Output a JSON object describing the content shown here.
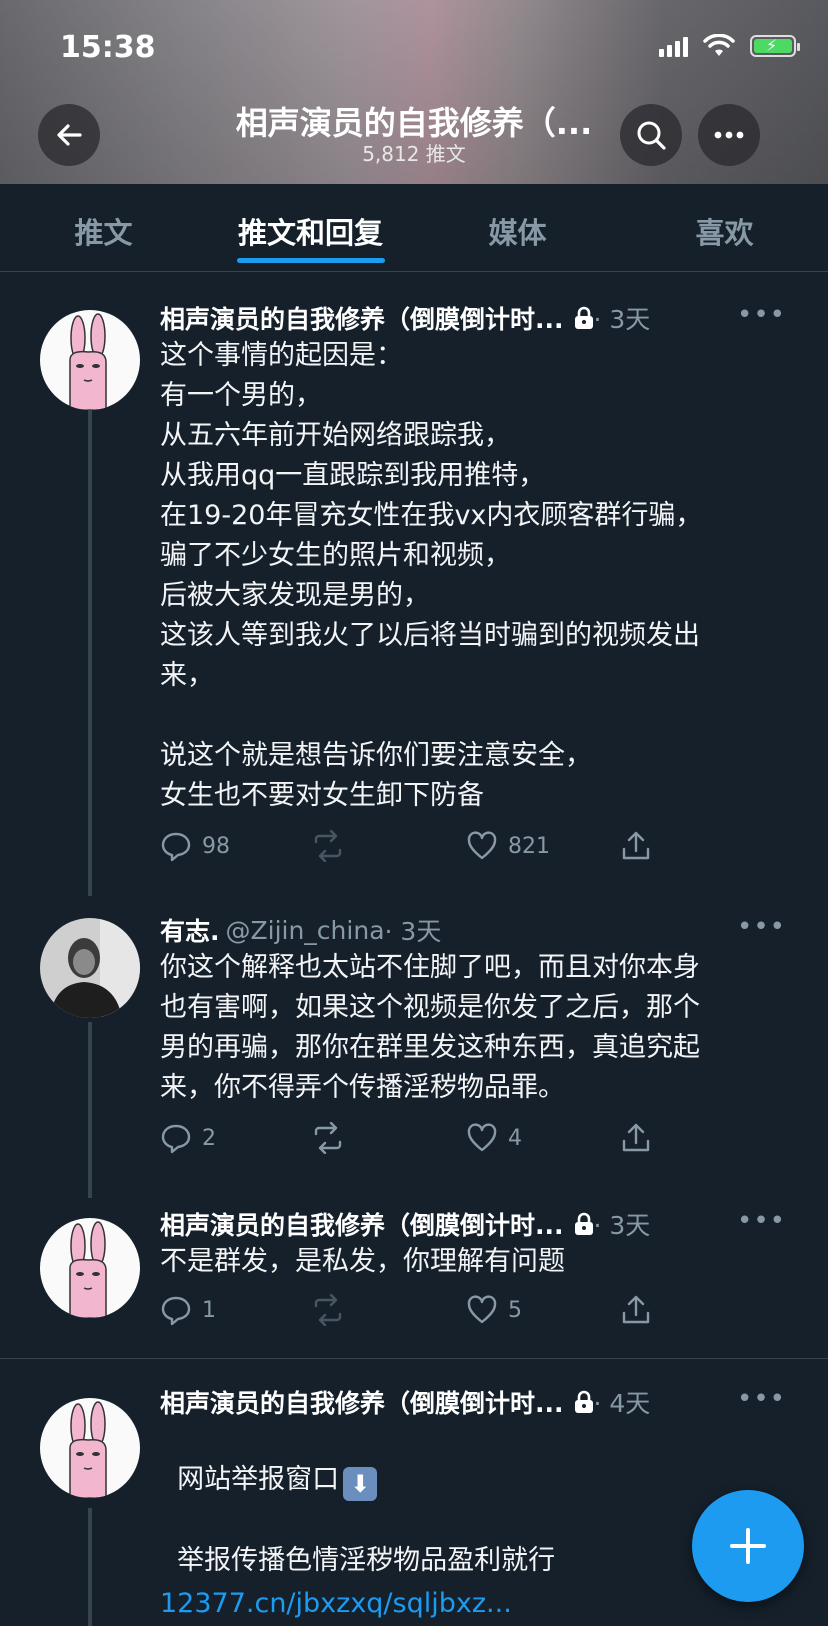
{
  "status_bar": {
    "time": "15:38"
  },
  "header": {
    "title": "相声演员的自我修养（...",
    "subtitle": "5,812 推文"
  },
  "tabs": [
    {
      "label": "推文",
      "active": false
    },
    {
      "label": "推文和回复",
      "active": true
    },
    {
      "label": "媒体",
      "active": false
    },
    {
      "label": "喜欢",
      "active": false
    }
  ],
  "tweets": [
    {
      "name": "相声演员的自我修养（倒膜倒计时...",
      "handle": "",
      "time": "· 3天",
      "locked": true,
      "body": "这个事情的起因是：\n有一个男的，\n从五六年前开始网络跟踪我，\n从我用qq一直跟踪到我用推特，\n在19-20年冒充女性在我vx内衣顾客群行骗，\n骗了不少女生的照片和视频，\n后被大家发现是男的，\n这该人等到我火了以后将当时骗到的视频发出\n来，\n\n说这个就是想告诉你们要注意安全，\n女生也不要对女生卸下防备",
      "replies": "98",
      "retweets": "",
      "likes": "821"
    },
    {
      "name": "有志.",
      "handle": "@Zijin_china",
      "time": "· 3天",
      "locked": false,
      "body": "你这个解释也太站不住脚了吧，而且对你本身\n也有害啊，如果这个视频是你发了之后，那个\n男的再骗，那你在群里发这种东西，真追究起\n来，你不得弄个传播淫秽物品罪。",
      "replies": "2",
      "retweets": "",
      "likes": "4"
    },
    {
      "name": "相声演员的自我修养（倒膜倒计时...",
      "handle": "",
      "time": "· 3天",
      "locked": true,
      "body": "不是群发，是私发，你理解有问题",
      "replies": "1",
      "retweets": "",
      "likes": "5"
    },
    {
      "name": "相声演员的自我修养（倒膜倒计时...",
      "handle": "",
      "time": "· 4天",
      "locked": true,
      "body_line1": "网站举报窗口",
      "body_line2": "举报传播色情淫秽物品盈利就行",
      "link": "12377.cn/jbxzxq/sqljbxz..."
    }
  ],
  "more_label": "•••",
  "colors": {
    "accent": "#1d9bf0",
    "background": "#15202b",
    "muted": "#8899a6"
  }
}
